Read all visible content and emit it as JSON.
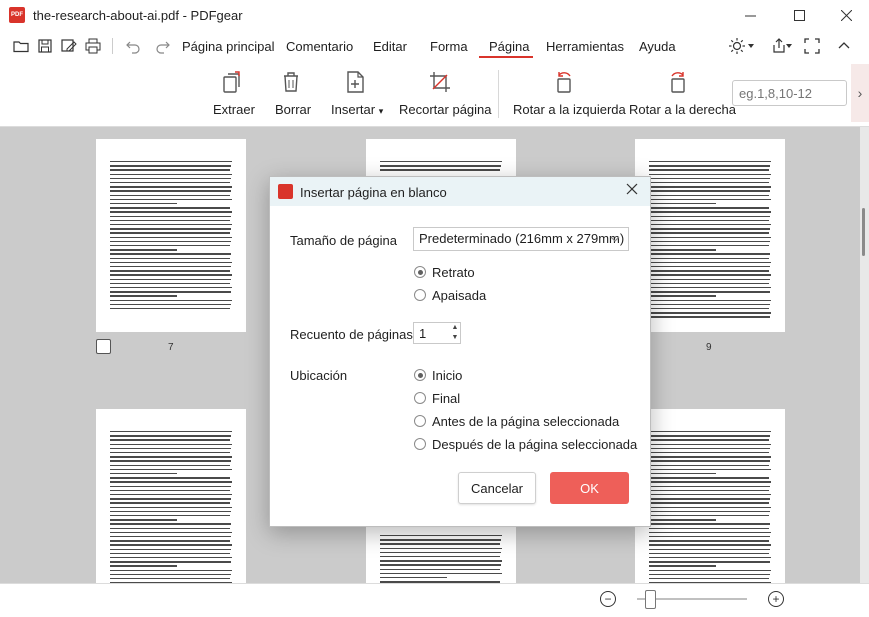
{
  "window": {
    "title": "the-research-about-ai.pdf - PDFgear",
    "logo_text": "PDF"
  },
  "menu": {
    "items": [
      "Página principal",
      "Comentario",
      "Editar",
      "Forma",
      "Página",
      "Herramientas",
      "Ayuda"
    ],
    "active": "Página"
  },
  "ribbon": {
    "extract": "Extraer",
    "delete": "Borrar",
    "insert": "Insertar",
    "crop": "Recortar página",
    "rotate_left": "Rotar a la izquierda",
    "rotate_right": "Rotar a la derecha",
    "page_range_placeholder": "eg.1,8,10-12"
  },
  "pages": {
    "p7": "7",
    "p9": "9"
  },
  "dialog": {
    "title": "Insertar página en blanco",
    "page_size_label": "Tamaño de página",
    "page_size_value": "Predeterminado (216mm x 279mm)",
    "orientation": {
      "portrait": "Retrato",
      "landscape": "Apaisada",
      "selected": "portrait"
    },
    "page_count_label": "Recuento de páginas",
    "page_count_value": "1",
    "location_label": "Ubicación",
    "location": {
      "start": "Inicio",
      "end": "Final",
      "before": "Antes de la página seleccionada",
      "after": "Después de la página seleccionada",
      "selected": "start"
    },
    "cancel": "Cancelar",
    "ok": "OK"
  },
  "colors": {
    "accent": "#d9342b",
    "ok_button": "#ee5f59"
  }
}
